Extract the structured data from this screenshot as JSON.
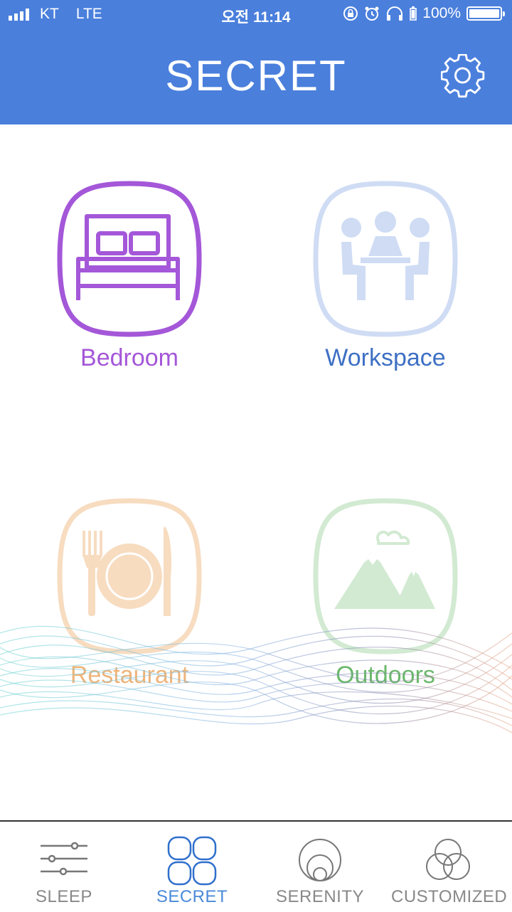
{
  "status_bar": {
    "carrier": "KT",
    "network": "LTE",
    "time": "오전 11:14",
    "battery": "100%"
  },
  "header": {
    "title": "SECRET"
  },
  "tiles": [
    {
      "label": "Bedroom",
      "color": "#a457d8"
    },
    {
      "label": "Workspace",
      "color": "#4a7fd0"
    },
    {
      "label": "Restaurant",
      "color": "#eeb47a"
    },
    {
      "label": "Outdoors",
      "color": "#6ab86a"
    }
  ],
  "tabs": [
    {
      "label": "SLEEP"
    },
    {
      "label": "SECRET"
    },
    {
      "label": "SERENITY"
    },
    {
      "label": "CUSTOMIZED"
    }
  ],
  "colors": {
    "header_bg": "#4a7fdc",
    "active_tab": "#4a8ad8",
    "inactive_tab": "#888888"
  }
}
